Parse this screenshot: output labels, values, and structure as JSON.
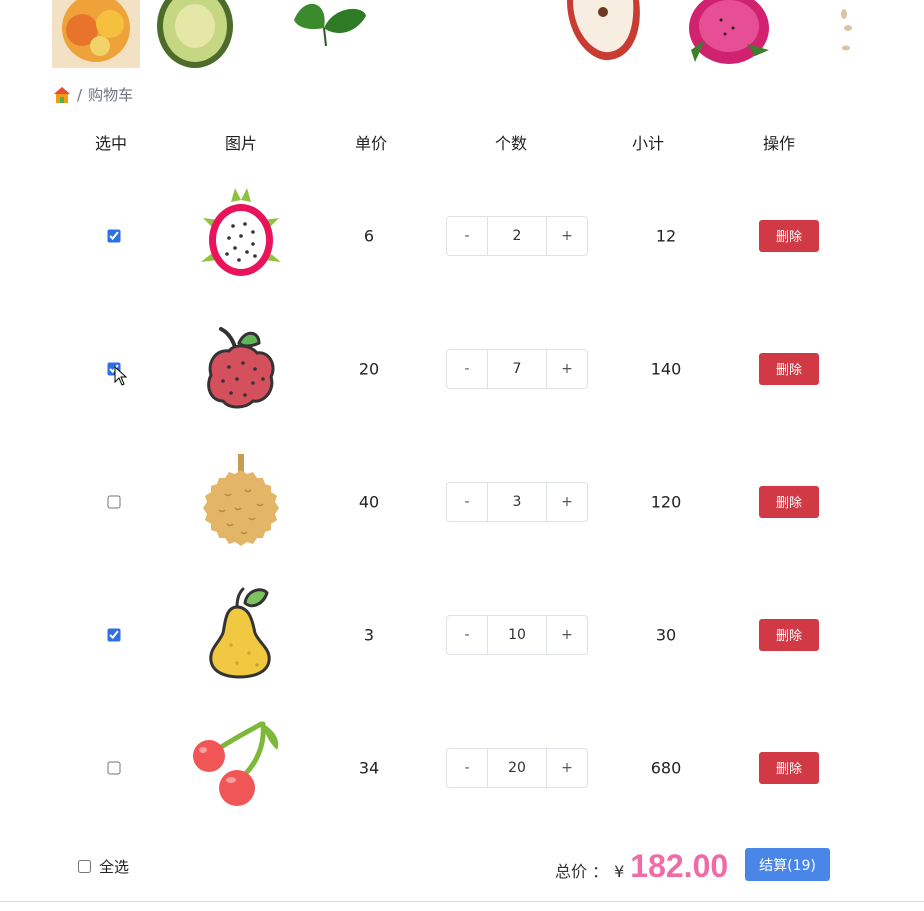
{
  "breadcrumb": {
    "home_icon": "home-icon",
    "separator": "/",
    "current": "购物车"
  },
  "table": {
    "headers": [
      "选中",
      "图片",
      "单价",
      "个数",
      "小计",
      "操作"
    ],
    "rows": [
      {
        "checked": true,
        "fruit_icon": "dragon-fruit-icon",
        "price": "6",
        "qty": "2",
        "subtotal": "12",
        "delete_label": "删除",
        "minus": "-",
        "plus": "+"
      },
      {
        "checked": true,
        "fruit_icon": "lychee-icon",
        "price": "20",
        "qty": "7",
        "subtotal": "140",
        "delete_label": "删除",
        "minus": "-",
        "plus": "+"
      },
      {
        "checked": false,
        "fruit_icon": "durian-icon",
        "price": "40",
        "qty": "3",
        "subtotal": "120",
        "delete_label": "删除",
        "minus": "-",
        "plus": "+"
      },
      {
        "checked": true,
        "fruit_icon": "pear-icon",
        "price": "3",
        "qty": "10",
        "subtotal": "30",
        "delete_label": "删除",
        "minus": "-",
        "plus": "+"
      },
      {
        "checked": false,
        "fruit_icon": "cherry-icon",
        "price": "34",
        "qty": "20",
        "subtotal": "680",
        "delete_label": "删除",
        "minus": "-",
        "plus": "+"
      }
    ]
  },
  "footer": {
    "select_all_label": "全选",
    "select_all_checked": false,
    "total_label": "总价 ：",
    "currency": "¥",
    "total_amount": "182.00",
    "checkout_label": "结算(19)"
  },
  "colors": {
    "delete": "#d13a45",
    "checkout": "#4a86e8",
    "total": "#f06aa8",
    "checkbox": "#2f6fe4"
  }
}
